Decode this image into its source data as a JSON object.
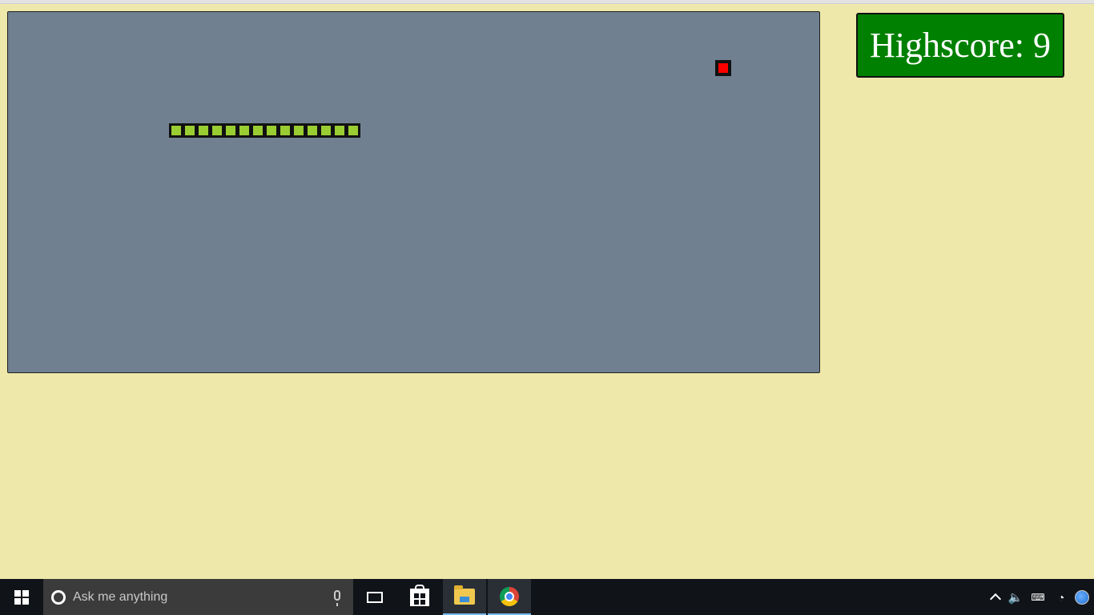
{
  "game": {
    "highscore_label": "Highscore: 9",
    "highscore": 9,
    "snake_length": 14,
    "board_color": "#708090",
    "snake_color": "#9acd32",
    "food_color": "#ff0000",
    "page_background": "#eee8aa",
    "highscore_background": "#008000"
  },
  "taskbar": {
    "search_placeholder": "Ask me anything",
    "icons": [
      "windows-start-icon",
      "cortana-icon",
      "microphone-icon",
      "task-view-icon",
      "store-icon",
      "file-explorer-icon",
      "chrome-icon"
    ],
    "tray_icons": [
      "show-hidden-icons-chevron",
      "volume-icon",
      "input-keyboard-icon",
      "wifi-icon",
      "notification-globe-icon"
    ]
  }
}
